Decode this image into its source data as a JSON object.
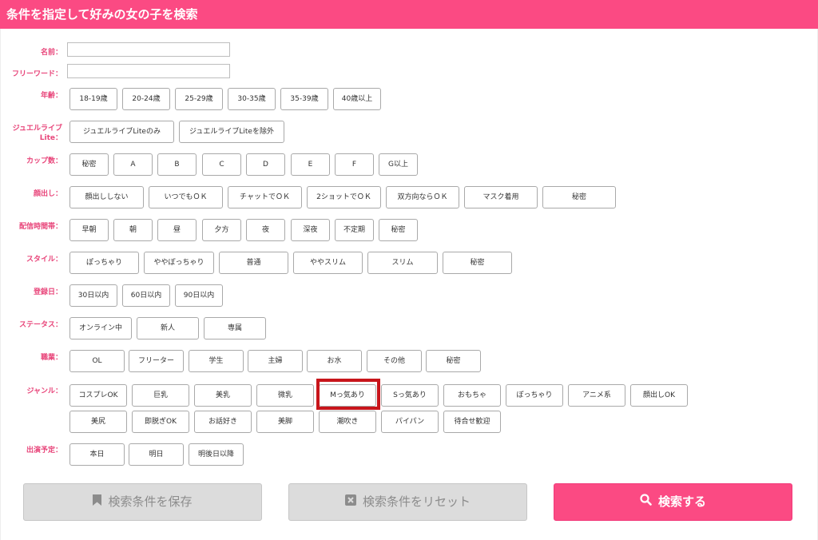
{
  "header": {
    "title": "条件を指定して好みの女の子を検索"
  },
  "fields": {
    "name_label": "名前：",
    "freeword_label": "フリーワード：",
    "age_label": "年齢：",
    "age": [
      "18-19歳",
      "20-24歳",
      "25-29歳",
      "30-35歳",
      "35-39歳",
      "40歳以上"
    ],
    "jewel_label": "ジュエルライブLite：",
    "jewel": [
      "ジュエルライブLiteのみ",
      "ジュエルライブLiteを除外"
    ],
    "cup_label": "カップ数：",
    "cup": [
      "秘密",
      "A",
      "B",
      "C",
      "D",
      "E",
      "F",
      "G以上"
    ],
    "face_label": "顔出し：",
    "face": [
      "顔出ししない",
      "いつでもＯＫ",
      "チャットでＯＫ",
      "2ショットでＯＫ",
      "双方向ならＯＫ",
      "マスク着用",
      "秘密"
    ],
    "time_label": "配信時間帯：",
    "time": [
      "早朝",
      "朝",
      "昼",
      "夕方",
      "夜",
      "深夜",
      "不定期",
      "秘密"
    ],
    "style_label": "スタイル：",
    "style": [
      "ぽっちゃり",
      "ややぽっちゃり",
      "普通",
      "ややスリム",
      "スリム",
      "秘密"
    ],
    "reg_label": "登録日：",
    "reg": [
      "30日以内",
      "60日以内",
      "90日以内"
    ],
    "status_label": "ステータス：",
    "status": [
      "オンライン中",
      "新人",
      "専属"
    ],
    "job_label": "職業：",
    "job": [
      "OL",
      "フリーター",
      "学生",
      "主婦",
      "お水",
      "その他",
      "秘密"
    ],
    "genre_label": "ジャンル：",
    "genre": [
      "コスプレOK",
      "巨乳",
      "美乳",
      "微乳",
      "Mっ気あり",
      "Sっ気あり",
      "おもちゃ",
      "ぽっちゃり",
      "アニメ系",
      "顔出しOK",
      "美尻",
      "即脱ぎOK",
      "お話好き",
      "美脚",
      "潮吹き",
      "パイパン",
      "待合せ歓迎"
    ],
    "sched_label": "出演予定：",
    "sched": [
      "本日",
      "明日",
      "明後日以降"
    ]
  },
  "actions": {
    "save": "検索条件を保存",
    "reset": "検索条件をリセット",
    "search": "検索する"
  },
  "icons": {
    "save": "bookmark-icon",
    "reset": "close-box-icon",
    "search": "search-icon"
  },
  "colors": {
    "accent": "#fb4a83",
    "label": "#e8457a",
    "highlight": "#c8151b"
  }
}
